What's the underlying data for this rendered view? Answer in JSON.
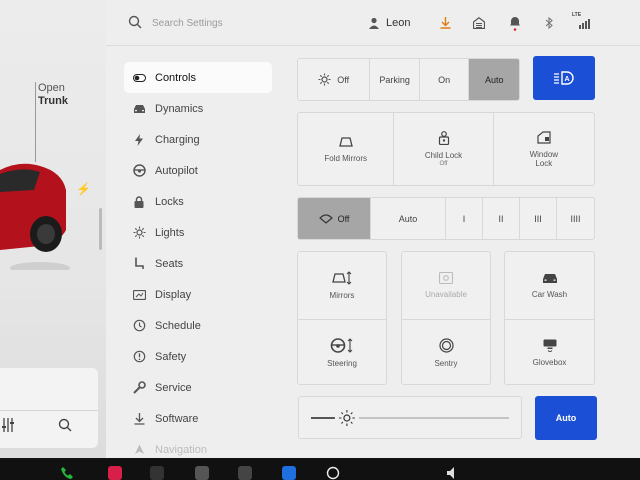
{
  "car": {
    "trunk_label_top": "Open",
    "trunk_label_bottom": "Trunk"
  },
  "topbar": {
    "search_placeholder": "Search Settings",
    "user_name": "Leon",
    "network_label": "LTE"
  },
  "nav": {
    "items": [
      {
        "label": "Controls",
        "icon": "toggle-icon"
      },
      {
        "label": "Dynamics",
        "icon": "car-icon"
      },
      {
        "label": "Charging",
        "icon": "bolt-icon"
      },
      {
        "label": "Autopilot",
        "icon": "steering-wheel-icon"
      },
      {
        "label": "Locks",
        "icon": "lock-icon"
      },
      {
        "label": "Lights",
        "icon": "sun-icon"
      },
      {
        "label": "Seats",
        "icon": "seat-icon"
      },
      {
        "label": "Display",
        "icon": "display-icon"
      },
      {
        "label": "Schedule",
        "icon": "clock-icon"
      },
      {
        "label": "Safety",
        "icon": "alert-icon"
      },
      {
        "label": "Service",
        "icon": "wrench-icon"
      },
      {
        "label": "Software",
        "icon": "download-icon"
      },
      {
        "label": "Navigation",
        "icon": "navigation-icon"
      }
    ]
  },
  "headlights": {
    "options": [
      "Off",
      "Parking",
      "On",
      "Auto"
    ],
    "selected": "Auto"
  },
  "controls_row": {
    "fold_mirrors": "Fold Mirrors",
    "child_lock": "Child Lock",
    "child_lock_state": "Off",
    "window_lock": "Window Lock"
  },
  "wipers": {
    "options": [
      "Off",
      "Auto",
      "I",
      "II",
      "III",
      "IIII"
    ],
    "selected": "Off"
  },
  "grid": {
    "mirrors": "Mirrors",
    "steering": "Steering",
    "unavailable": "Unavailable",
    "sentry": "Sentry",
    "car_wash": "Car Wash",
    "glovebox": "Glovebox"
  },
  "brightness": {
    "auto_label": "Auto",
    "level": 0.15
  },
  "colors": {
    "accent_blue": "#1a4fd6",
    "selected_gray": "#a6a6a6",
    "download_orange": "#e07b10",
    "notification_red": "#d9262b"
  }
}
